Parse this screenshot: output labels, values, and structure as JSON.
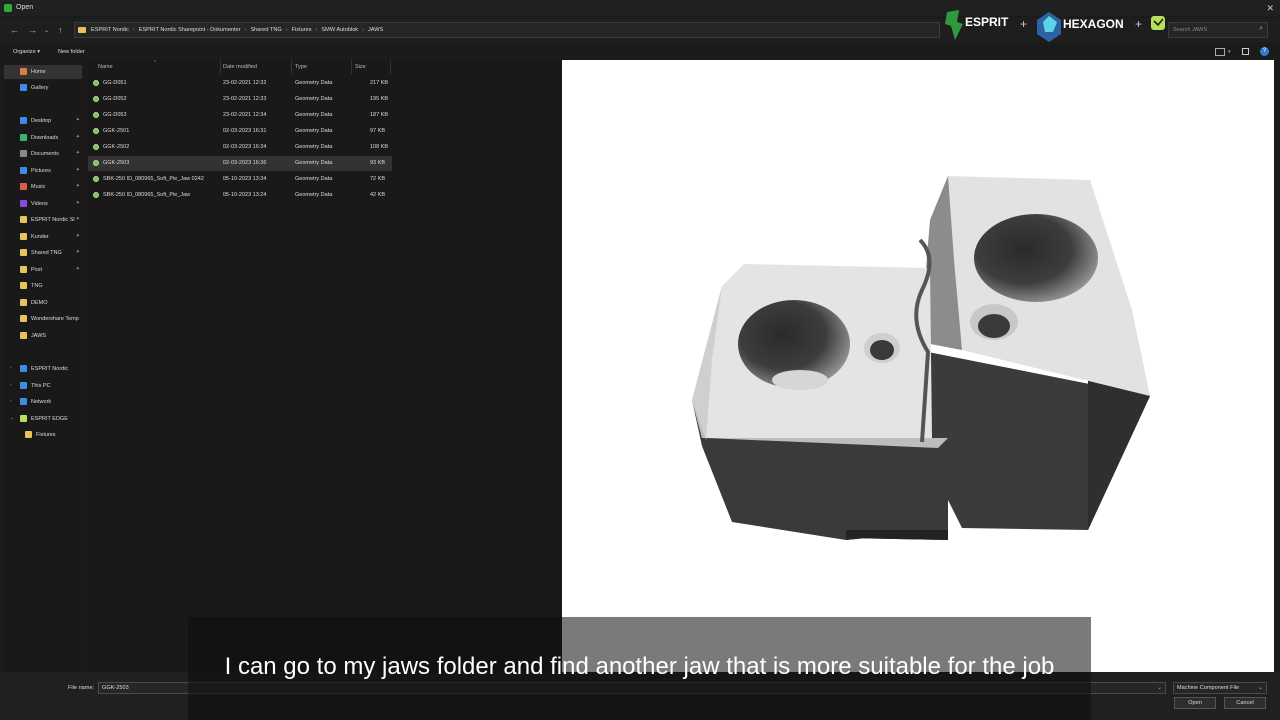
{
  "window": {
    "title": "Open"
  },
  "address": {
    "crumbs": [
      "ESPRIT Nordic",
      "ESPRIT Nordic Sharepoint - Dokumenter",
      "Shared TNG",
      "Fixtures",
      "SMW Autoblok",
      "JAWS"
    ]
  },
  "search": {
    "placeholder": "Search JAWS"
  },
  "brands": {
    "logo1": "ESPRIT",
    "logo2": "HEXAGON"
  },
  "toolbar": {
    "organize": "Organize ▾",
    "new_folder": "New folder"
  },
  "nav": {
    "items": [
      {
        "label": "Home",
        "icon": "home-icon",
        "color": "#e07b39",
        "pinned": false
      },
      {
        "label": "Gallery",
        "icon": "gallery-icon",
        "color": "#3a8ee6",
        "pinned": false
      },
      {
        "label": "Desktop",
        "icon": "desktop-icon",
        "color": "#3a8ee6",
        "pinned": true
      },
      {
        "label": "Downloads",
        "icon": "downloads-icon",
        "color": "#3bb36a",
        "pinned": true
      },
      {
        "label": "Documents",
        "icon": "documents-icon",
        "color": "#8a8a8a",
        "pinned": true
      },
      {
        "label": "Pictures",
        "icon": "pictures-icon",
        "color": "#3a8ee6",
        "pinned": true
      },
      {
        "label": "Music",
        "icon": "music-icon",
        "color": "#e05a4a",
        "pinned": true
      },
      {
        "label": "Videos",
        "icon": "videos-icon",
        "color": "#8a4ae0",
        "pinned": true
      },
      {
        "label": "ESPRIT Nordic Sl",
        "icon": "folder-icon",
        "color": "#e8c35a",
        "pinned": true
      },
      {
        "label": "Kunder",
        "icon": "folder-icon",
        "color": "#e8c35a",
        "pinned": true
      },
      {
        "label": "Shared TNG",
        "icon": "folder-icon",
        "color": "#e8c35a",
        "pinned": true
      },
      {
        "label": "Post",
        "icon": "folder-icon",
        "color": "#e8c35a",
        "pinned": true
      },
      {
        "label": "TNG",
        "icon": "folder-icon",
        "color": "#e8c35a",
        "pinned": false
      },
      {
        "label": "DEMO",
        "icon": "folder-icon",
        "color": "#e8c35a",
        "pinned": false
      },
      {
        "label": "Wondershare Temp",
        "icon": "folder-icon",
        "color": "#e8c35a",
        "pinned": false
      },
      {
        "label": "JAWS",
        "icon": "folder-icon",
        "color": "#e8c35a",
        "pinned": false
      },
      {
        "label": "ESPRIT Nordic",
        "icon": "cloud-icon",
        "color": "#3a8ee6",
        "pinned": false
      },
      {
        "label": "This PC",
        "icon": "pc-icon",
        "color": "#3a8ee6",
        "pinned": false
      },
      {
        "label": "Network",
        "icon": "network-icon",
        "color": "#3a8ee6",
        "pinned": false
      },
      {
        "label": "ESPRIT EDGE",
        "icon": "esprit-edge-icon",
        "color": "#b8e05a",
        "pinned": false
      },
      {
        "label": "Fixtures",
        "icon": "folder-icon",
        "color": "#e8c35a",
        "pinned": false
      }
    ]
  },
  "files": {
    "columns": [
      "Name",
      "Date modified",
      "Type",
      "Size"
    ],
    "rows": [
      {
        "name": "GG-D051",
        "date": "23-02-2021 12:32",
        "type": "Geometry Data",
        "size": "217 KB"
      },
      {
        "name": "GG-D052",
        "date": "23-02-2021 12:33",
        "type": "Geometry Data",
        "size": "195 KB"
      },
      {
        "name": "GG-D053",
        "date": "23-02-2021 12:34",
        "type": "Geometry Data",
        "size": "187 KB"
      },
      {
        "name": "GGK-2501",
        "date": "02-03-2023 16:31",
        "type": "Geometry Data",
        "size": "97 KB"
      },
      {
        "name": "GGK-2502",
        "date": "02-03-2023 16:34",
        "type": "Geometry Data",
        "size": "108 KB"
      },
      {
        "name": "GGK-2503",
        "date": "02-03-2023 16:36",
        "type": "Geometry Data",
        "size": "93 KB"
      },
      {
        "name": "SBK-250 ID_080965_Soft_Pie_Jaw 0242",
        "date": "05-10-2023 13:34",
        "type": "Geometry Data",
        "size": "72 KB"
      },
      {
        "name": "SBK-250 ID_080965_Soft_Pie_Jaw",
        "date": "05-10-2023 13:24",
        "type": "Geometry Data",
        "size": "42 KB"
      }
    ],
    "selected_index": 5
  },
  "footer": {
    "file_name_label": "File name:",
    "file_name_value": "GGK-2503",
    "filter": "Machine Component File",
    "open": "Open",
    "cancel": "Cancel"
  },
  "caption": "I can go to my jaws folder and find another jaw that is more suitable for the job"
}
